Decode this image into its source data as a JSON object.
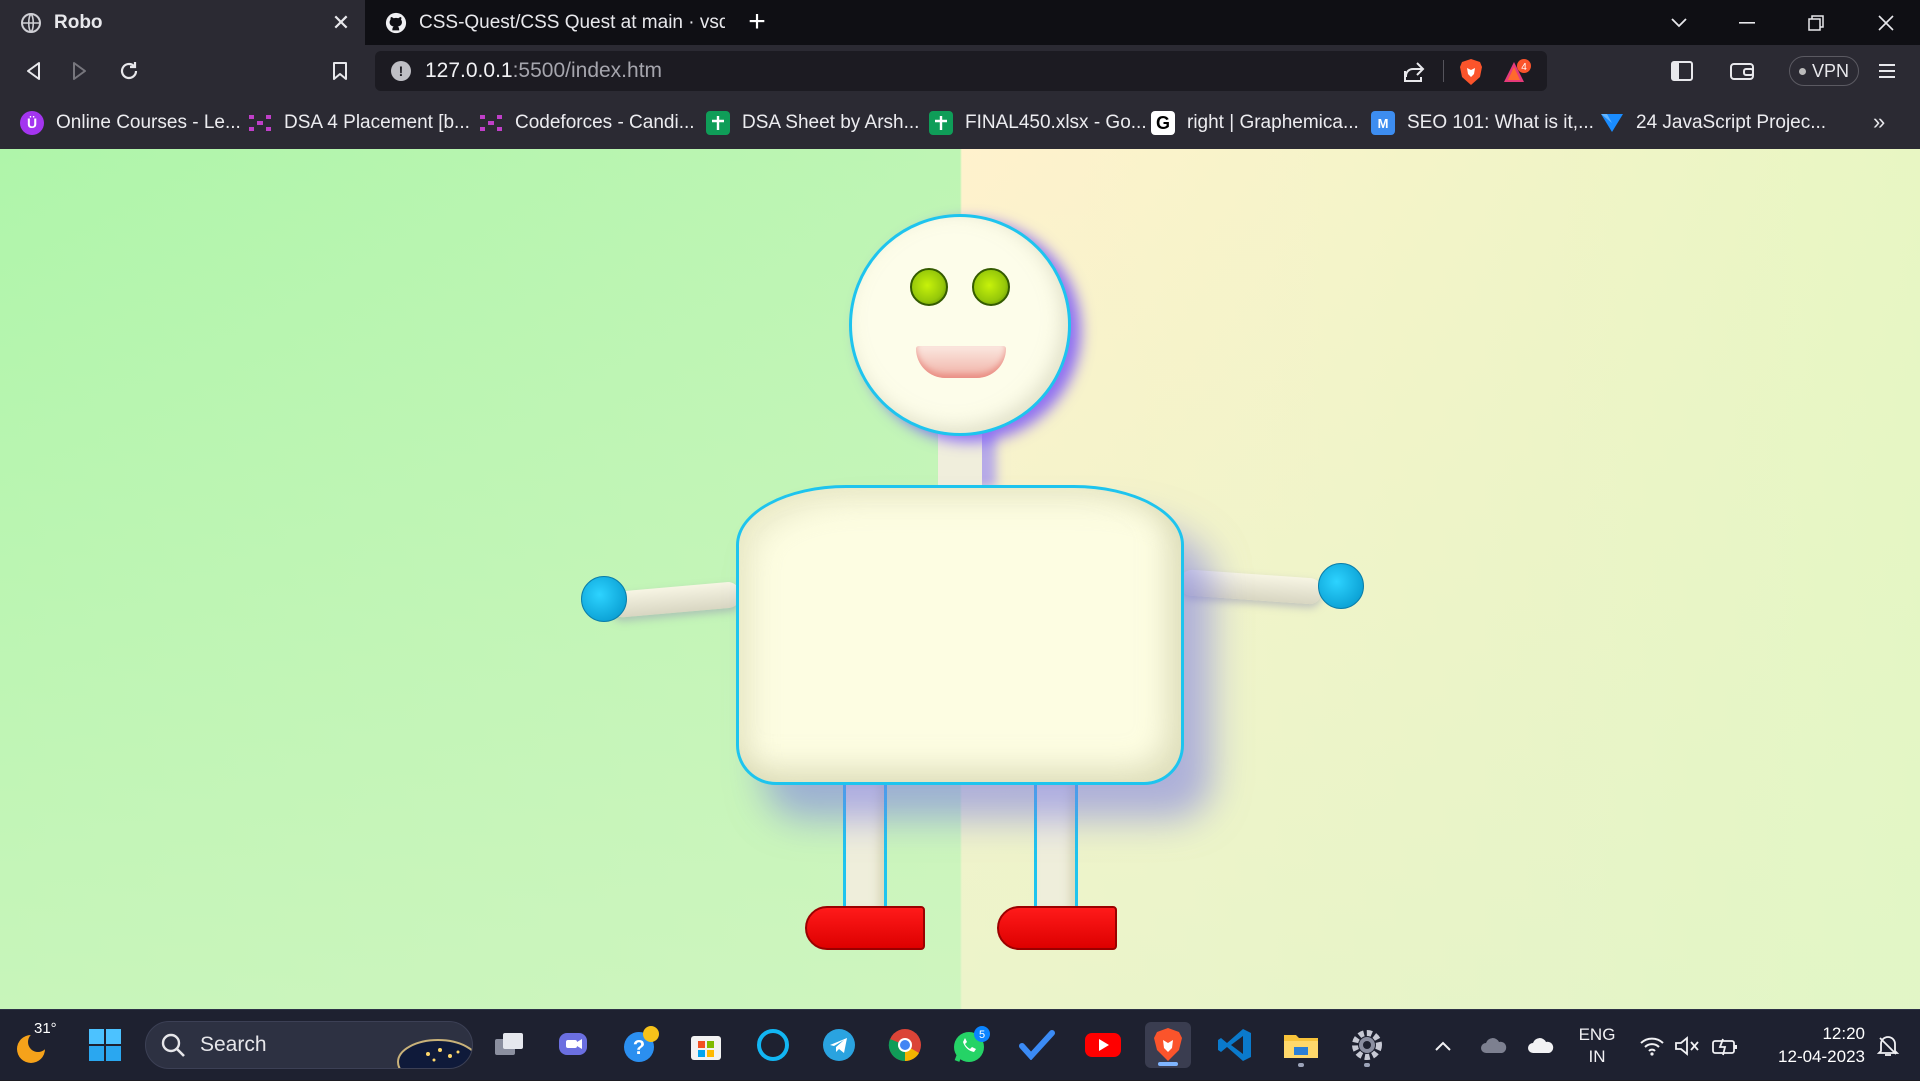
{
  "browser": {
    "tabs": [
      {
        "title": "Robo",
        "active": true
      },
      {
        "title": "CSS-Quest/CSS Quest at main · vsquar",
        "active": false
      }
    ],
    "url_host": "127.0.0.1",
    "url_path": ":5500/index.htm",
    "rewards_badge": "4",
    "vpn_label": "VPN",
    "bookmarks_more": "»",
    "bookmarks": [
      {
        "label": "Online Courses - Le...",
        "icon": "udemy-icon",
        "color": "#a435f0"
      },
      {
        "label": "DSA 4 Placement [b...",
        "icon": "codeforces-icon",
        "color": "#c03fc9"
      },
      {
        "label": "Codeforces - Candi...",
        "icon": "codeforces-icon",
        "color": "#c03fc9"
      },
      {
        "label": "DSA Sheet by Arsh...",
        "icon": "sheets-icon",
        "color": "#0f9d58"
      },
      {
        "label": "FINAL450.xlsx - Go...",
        "icon": "sheets-icon",
        "color": "#0f9d58"
      },
      {
        "label": "right | Graphemica...",
        "icon": "graphemica-icon",
        "color": "#ffffff"
      },
      {
        "label": "SEO 101: What is it,...",
        "icon": "moz-icon",
        "color": "#3d8df0"
      },
      {
        "label": "24 JavaScript Projec...",
        "icon": "vercel-blue-icon",
        "color": "#1a8cff"
      }
    ]
  },
  "page": {
    "colors": {
      "outline": "#1ec4ee",
      "hands": "#0ea5d8",
      "eyes": "#96c80a",
      "shoes": "#dd0000",
      "body": "#fdfde2"
    }
  },
  "taskbar": {
    "temperature": "31°",
    "search_label": "Search",
    "whatsapp_badge": "5",
    "language_line1": "ENG",
    "language_line2": "IN",
    "time": "12:20",
    "date": "12-04-2023"
  }
}
